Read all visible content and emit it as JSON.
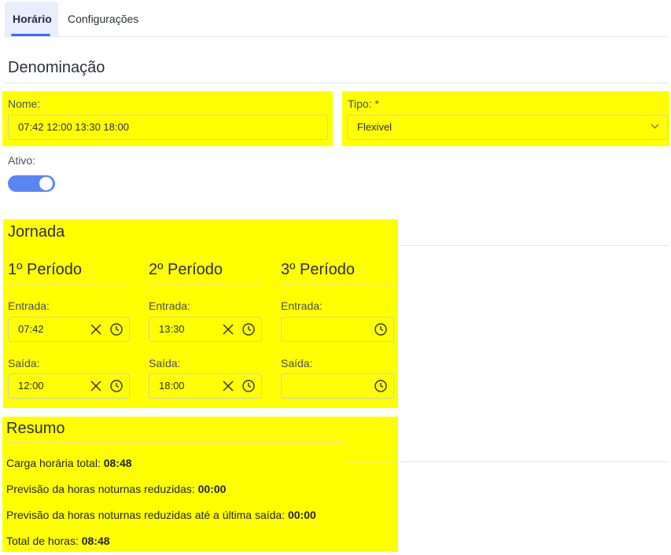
{
  "tabs": [
    {
      "label": "Horário",
      "active": true
    },
    {
      "label": "Configurações",
      "active": false
    }
  ],
  "denominacao": {
    "title": "Denominação",
    "nome_label": "Nome:",
    "nome_value": "07:42 12:00 13:30 18:00",
    "tipo_label": "Tipo: *",
    "tipo_value": "Flexivel",
    "ativo_label": "Ativo:",
    "ativo_on": true
  },
  "jornada": {
    "title": "Jornada",
    "periods": [
      {
        "title": "1º Período",
        "entrada_label": "Entrada:",
        "entrada_value": "07:42",
        "saida_label": "Saída:",
        "saida_value": "12:00"
      },
      {
        "title": "2º Período",
        "entrada_label": "Entrada:",
        "entrada_value": "13:30",
        "saida_label": "Saída:",
        "saida_value": "18:00"
      },
      {
        "title": "3º Período",
        "entrada_label": "Entrada:",
        "entrada_value": "",
        "saida_label": "Saída:",
        "saida_value": ""
      }
    ]
  },
  "resumo": {
    "title": "Resumo",
    "items": [
      {
        "label": "Carga horária total: ",
        "value": "08:48"
      },
      {
        "label": "Previsão da horas noturnas reduzidas: ",
        "value": "00:00"
      },
      {
        "label": "Previsão da horas noturnas reduzidas até a última saída: ",
        "value": "00:00"
      },
      {
        "label": "Total de horas: ",
        "value": "08:48"
      }
    ]
  },
  "colors": {
    "highlight": "#ffff00",
    "accent": "#3b6df0",
    "toggle": "#5a86f5"
  }
}
